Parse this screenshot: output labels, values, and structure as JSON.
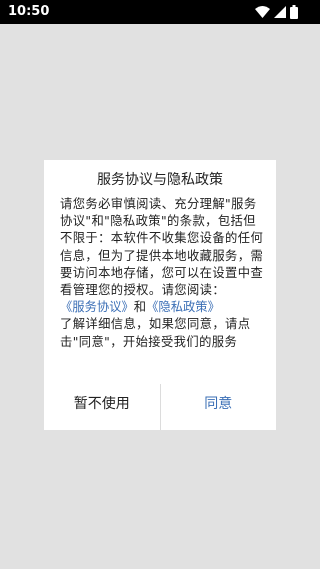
{
  "status_bar": {
    "time": "10:50",
    "icons": [
      "wifi-icon",
      "signal-icon",
      "battery-icon"
    ]
  },
  "dialog": {
    "title": "服务协议与隐私政策",
    "intro": "请您务必审慎阅读、充分理解\"服务协议\"和\"隐私政策\"的条款，包括但不限于：本软件不收集您设备的任何信息，但为了提供本地收藏服务，需要访问本地存储，您可以在设置中查看管理您的授权。请您阅读：",
    "link_service": "《服务协议》",
    "link_and": "和",
    "link_privacy": "《隐私政策》",
    "outro": "了解详细信息，如果您同意，请点击\"同意\"，开始接受我们的服务",
    "cancel_label": "暂不使用",
    "agree_label": "同意"
  },
  "colors": {
    "accent": "#3b6fb6",
    "background": "#e1e1e1",
    "status_bar": "#000000"
  }
}
